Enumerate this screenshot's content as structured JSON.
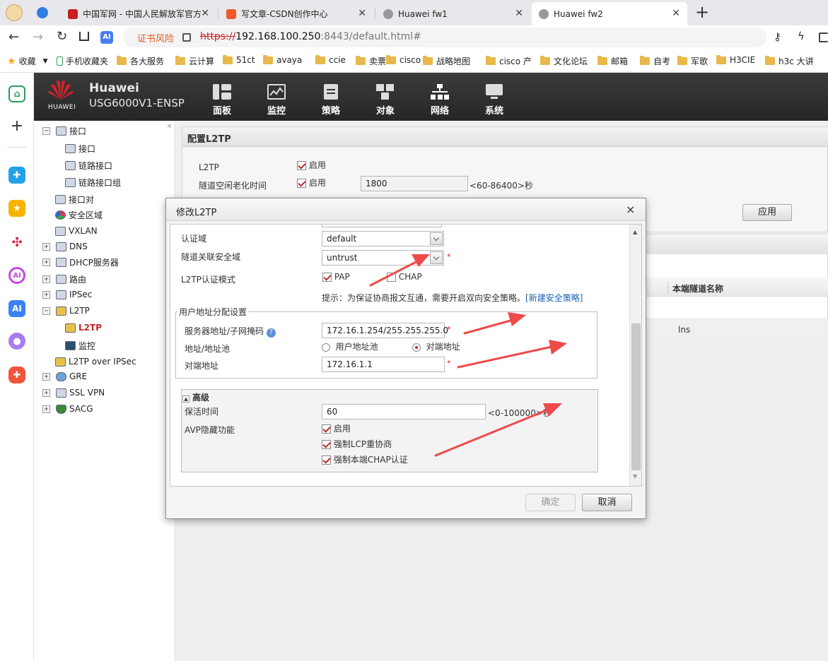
{
  "browser": {
    "tabs": [
      {
        "label": "中国军网 - 中国人民解放军官方",
        "favicon_color": "#c81e1e"
      },
      {
        "label": "写文章-CSDN创作中心",
        "favicon_color": "#f05a28"
      },
      {
        "label": "Huawei fw1",
        "favicon_color": "#888888"
      },
      {
        "label": "Huawei fw2",
        "favicon_color": "#888888"
      }
    ],
    "new_tab": "+",
    "cert_warning": "证书风险",
    "url_scheme": "https://",
    "url_host": "192.168.100.250",
    "url_rest": ":8443/default.html#",
    "favorites_label": "收藏",
    "bookmarks": [
      "手机收藏夹",
      "各大服务",
      "云计算",
      "51ct",
      "avaya",
      "ccie",
      "卖票",
      "cisco",
      "战略地图",
      "cisco 产",
      "文化论坛",
      "邮箱",
      "自考",
      "军歌",
      "H3CIE",
      "h3c 大讲"
    ]
  },
  "app": {
    "brand": "Huawei",
    "model": "USG6000V1-ENSP",
    "logo_text": "HUAWEI",
    "nav": [
      "面板",
      "监控",
      "策略",
      "对象",
      "网络",
      "系统"
    ]
  },
  "tree": {
    "collapse_glyph": "«",
    "items": [
      {
        "label": "接口",
        "expander": "−"
      },
      {
        "label": "接口",
        "expander": ""
      },
      {
        "label": "链路接口",
        "expander": ""
      },
      {
        "label": "链路接口组",
        "expander": ""
      },
      {
        "label": "接口对",
        "expander": ""
      },
      {
        "label": "安全区域",
        "expander": ""
      },
      {
        "label": "VXLAN",
        "expander": ""
      },
      {
        "label": "DNS",
        "expander": "+"
      },
      {
        "label": "DHCP服务器",
        "expander": "+"
      },
      {
        "label": "路由",
        "expander": "+"
      },
      {
        "label": "IPSec",
        "expander": "+"
      },
      {
        "label": "L2TP",
        "expander": "−"
      },
      {
        "label": "L2TP",
        "expander": ""
      },
      {
        "label": "监控",
        "expander": ""
      },
      {
        "label": "L2TP over IPSec",
        "expander": ""
      },
      {
        "label": "GRE",
        "expander": "+"
      },
      {
        "label": "SSL VPN",
        "expander": "+"
      },
      {
        "label": "SACG",
        "expander": "+"
      }
    ]
  },
  "page": {
    "title": "配置L2TP",
    "l2tp_label": "L2TP",
    "enable_label": "启用",
    "idle_label": "隧道空闲老化时间",
    "idle_value": "1800",
    "idle_hint": "<60-86400>秒",
    "apply": "应用",
    "table_header": "本端隧道名称",
    "table_cell": "lns"
  },
  "modal": {
    "title": "修改L2TP",
    "close": "×",
    "auth_domain_label": "认证域",
    "auth_domain_value": "default",
    "zone_label": "隧道关联安全域",
    "zone_value": "untrust",
    "auth_mode_label": "L2TP认证模式",
    "pap": "PAP",
    "chap": "CHAP",
    "hint_text": "提示：为保证协商报文互通，需要开启双向安全策略。",
    "hint_link": "[新建安全策略]",
    "alloc_legend": "用户地址分配设置",
    "server_addr_label": "服务器地址/子网掩码",
    "server_addr_value": "172.16.1.254/255.255.255.0",
    "pool_label": "地址/地址池",
    "pool_opt_user": "用户地址池",
    "pool_opt_peer": "对端地址",
    "peer_label": "对端地址",
    "peer_value": "172.16.1.1",
    "adv_label": "高级",
    "keepalive_label": "保活时间",
    "keepalive_value": "60",
    "keepalive_hint": "<0-100000>秒",
    "avp_label": "AVP隐藏功能",
    "avp_enable": "启用",
    "lcp": "强制LCP重协商",
    "chap_local": "强制本端CHAP认证",
    "ok": "确定",
    "cancel": "取消",
    "required_mark": "*"
  },
  "colors": {
    "accent_red": "#c0282a",
    "arrow": "#ee4a4a",
    "link": "#1a5fb4"
  }
}
